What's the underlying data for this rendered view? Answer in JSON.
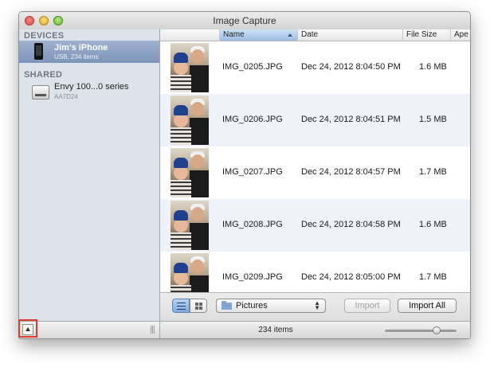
{
  "window": {
    "title": "Image Capture"
  },
  "sidebar": {
    "devices_header": "DEVICES",
    "device": {
      "name": "Jim's iPhone",
      "detail": "USB, 234 items"
    },
    "shared_header": "SHARED",
    "shared_device": {
      "name": "Envy 100...0 series",
      "detail": "AA7D24"
    }
  },
  "columns": [
    {
      "label": "Name",
      "sorted": true
    },
    {
      "label": "Date"
    },
    {
      "label": "File Size"
    },
    {
      "label": "Ape"
    }
  ],
  "rows": [
    {
      "name": "IMG_0205.JPG",
      "date": "Dec 24, 2012 8:04:50 PM",
      "size": "1.6 MB"
    },
    {
      "name": "IMG_0206.JPG",
      "date": "Dec 24, 2012 8:04:51 PM",
      "size": "1.5 MB"
    },
    {
      "name": "IMG_0207.JPG",
      "date": "Dec 24, 2012 8:04:57 PM",
      "size": "1.7 MB"
    },
    {
      "name": "IMG_0208.JPG",
      "date": "Dec 24, 2012 8:04:58 PM",
      "size": "1.6 MB"
    },
    {
      "name": "IMG_0209.JPG",
      "date": "Dec 24, 2012 8:05:00 PM",
      "size": "1.7 MB"
    }
  ],
  "toolbar": {
    "import_to": "Pictures",
    "import_label": "Import",
    "import_all_label": "Import All"
  },
  "status": {
    "item_count": "234 items",
    "thumbnail_zoom": 0.75
  },
  "icons": {
    "device": "iphone-icon",
    "shared": "printer-icon",
    "destination": "folder-icon",
    "list_view": "list-view-icon",
    "icon_view": "icon-grid-icon",
    "sidebar_toggle": "eject-icon"
  },
  "colors": {
    "selection": "#8ca1c4",
    "sidebar_bg": "#dde3ea",
    "row_alt": "#eff3f9",
    "highlight": "#e23b2e"
  }
}
